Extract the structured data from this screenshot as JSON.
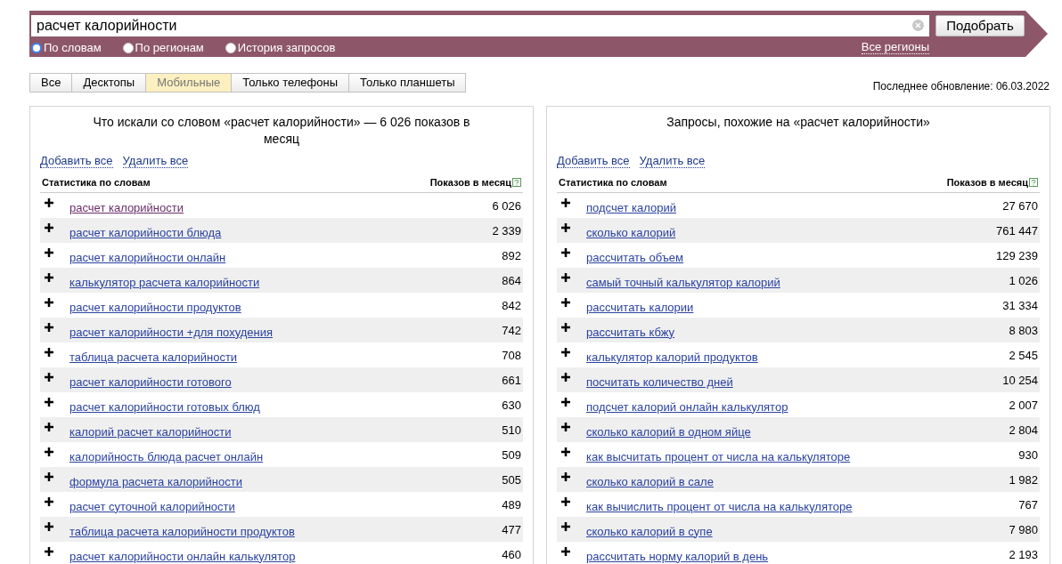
{
  "search": {
    "value": "расчет калорийности",
    "button": "Подобрать",
    "modes": [
      {
        "label": "По словам",
        "selected": true
      },
      {
        "label": "По регионам",
        "selected": false
      },
      {
        "label": "История запросов",
        "selected": false
      }
    ],
    "regions_link": "Все регионы"
  },
  "tabs": [
    {
      "label": "Все",
      "selected": false
    },
    {
      "label": "Десктопы",
      "selected": false
    },
    {
      "label": "Мобильные",
      "selected": true
    },
    {
      "label": "Только телефоны",
      "selected": false
    },
    {
      "label": "Только планшеты",
      "selected": false
    }
  ],
  "last_update": "Последнее обновление: 06.03.2022",
  "panels": [
    {
      "title": "Что искали со словом «расчет калорийности» — 6 026 показов в месяц",
      "add_all": "Добавить все",
      "remove_all": "Удалить все",
      "column_1": "Статистика по словам",
      "column_2": "Показов в месяц",
      "rows": [
        {
          "phrase": "расчет калорийности",
          "count": "6 026",
          "visited": true
        },
        {
          "phrase": "расчет калорийности блюда",
          "count": "2 339",
          "visited": false
        },
        {
          "phrase": "расчет калорийности онлайн",
          "count": "892",
          "visited": false
        },
        {
          "phrase": "калькулятор расчета калорийности",
          "count": "864",
          "visited": false
        },
        {
          "phrase": "расчет калорийности продуктов",
          "count": "842",
          "visited": false
        },
        {
          "phrase": "расчет калорийности +для похудения",
          "count": "742",
          "visited": false
        },
        {
          "phrase": "таблица расчета калорийности",
          "count": "708",
          "visited": false
        },
        {
          "phrase": "расчет калорийности готового",
          "count": "661",
          "visited": false
        },
        {
          "phrase": "расчет калорийности готовых блюд",
          "count": "630",
          "visited": false
        },
        {
          "phrase": "калорий расчет калорийности",
          "count": "510",
          "visited": false
        },
        {
          "phrase": "калорийность блюда расчет онлайн",
          "count": "509",
          "visited": false
        },
        {
          "phrase": "формула расчета калорийности",
          "count": "505",
          "visited": false
        },
        {
          "phrase": "расчет суточной калорийности",
          "count": "489",
          "visited": false
        },
        {
          "phrase": "таблица расчета калорийности продуктов",
          "count": "477",
          "visited": false
        },
        {
          "phrase": "расчет калорийности онлайн калькулятор",
          "count": "460",
          "visited": false
        }
      ]
    },
    {
      "title": "Запросы, похожие на «расчет калорийности»",
      "add_all": "Добавить все",
      "remove_all": "Удалить все",
      "column_1": "Статистика по словам",
      "column_2": "Показов в месяц",
      "rows": [
        {
          "phrase": "подсчет калорий",
          "count": "27 670",
          "visited": false
        },
        {
          "phrase": "сколько калорий",
          "count": "761 447",
          "visited": false
        },
        {
          "phrase": "рассчитать объем",
          "count": "129 239",
          "visited": false
        },
        {
          "phrase": "самый точный калькулятор калорий",
          "count": "1 026",
          "visited": false
        },
        {
          "phrase": "рассчитать калории",
          "count": "31 334",
          "visited": false
        },
        {
          "phrase": "рассчитать кбжу",
          "count": "8 803",
          "visited": false
        },
        {
          "phrase": "калькулятор калорий продуктов",
          "count": "2 545",
          "visited": false
        },
        {
          "phrase": "посчитать количество дней",
          "count": "10 254",
          "visited": false
        },
        {
          "phrase": "подсчет калорий онлайн калькулятор",
          "count": "2 007",
          "visited": false
        },
        {
          "phrase": "сколько калорий в одном яйце",
          "count": "2 804",
          "visited": false
        },
        {
          "phrase": "как высчитать процент от числа на калькуляторе",
          "count": "930",
          "visited": false
        },
        {
          "phrase": "сколько калорий в сале",
          "count": "1 982",
          "visited": false
        },
        {
          "phrase": "как вычислить процент от числа на калькуляторе",
          "count": "767",
          "visited": false
        },
        {
          "phrase": "сколько калорий в супе",
          "count": "7 980",
          "visited": false
        },
        {
          "phrase": "рассчитать норму калорий в день",
          "count": "2 193",
          "visited": false
        }
      ]
    }
  ]
}
